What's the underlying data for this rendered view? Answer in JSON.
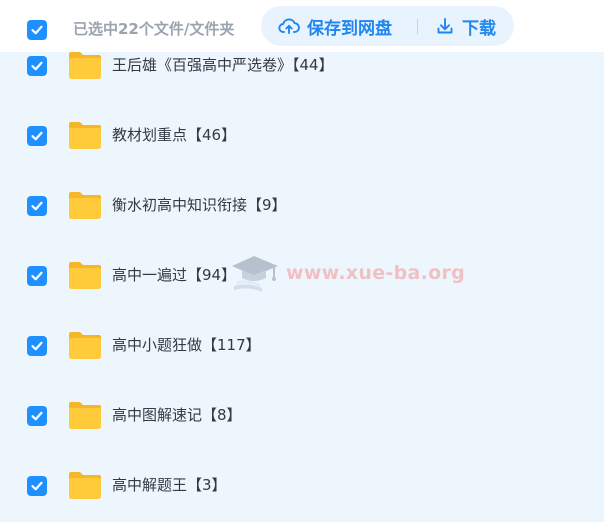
{
  "header": {
    "selection_text": "已选中22个文件/文件夹",
    "save_label": "保存到网盘",
    "download_label": "下载",
    "icons": {
      "save": "cloud-upload-icon",
      "download": "download-icon",
      "select_all": "checkbox-checked-icon"
    }
  },
  "files": [
    {
      "name": "王后雄《百强高中严选卷》【44】",
      "checked": true,
      "icon": "folder-icon"
    },
    {
      "name": "教材划重点【46】",
      "checked": true,
      "icon": "folder-icon"
    },
    {
      "name": "衡水初高中知识衔接【9】",
      "checked": true,
      "icon": "folder-icon"
    },
    {
      "name": "高中一遍过【94】",
      "checked": true,
      "icon": "folder-icon"
    },
    {
      "name": "高中小题狂做【117】",
      "checked": true,
      "icon": "folder-icon"
    },
    {
      "name": "高中图解速记【8】",
      "checked": true,
      "icon": "folder-icon"
    },
    {
      "name": "高中解题王【3】",
      "checked": true,
      "icon": "folder-icon"
    }
  ],
  "watermark": {
    "text": "www.xue-ba.org",
    "icon": "graduation-cap-icon"
  },
  "colors": {
    "accent": "#1e87f0",
    "checkbox": "#1e90ff",
    "list_background": "#eef6fd",
    "folder": "#ffc933",
    "muted_text": "#9aa3b0"
  }
}
